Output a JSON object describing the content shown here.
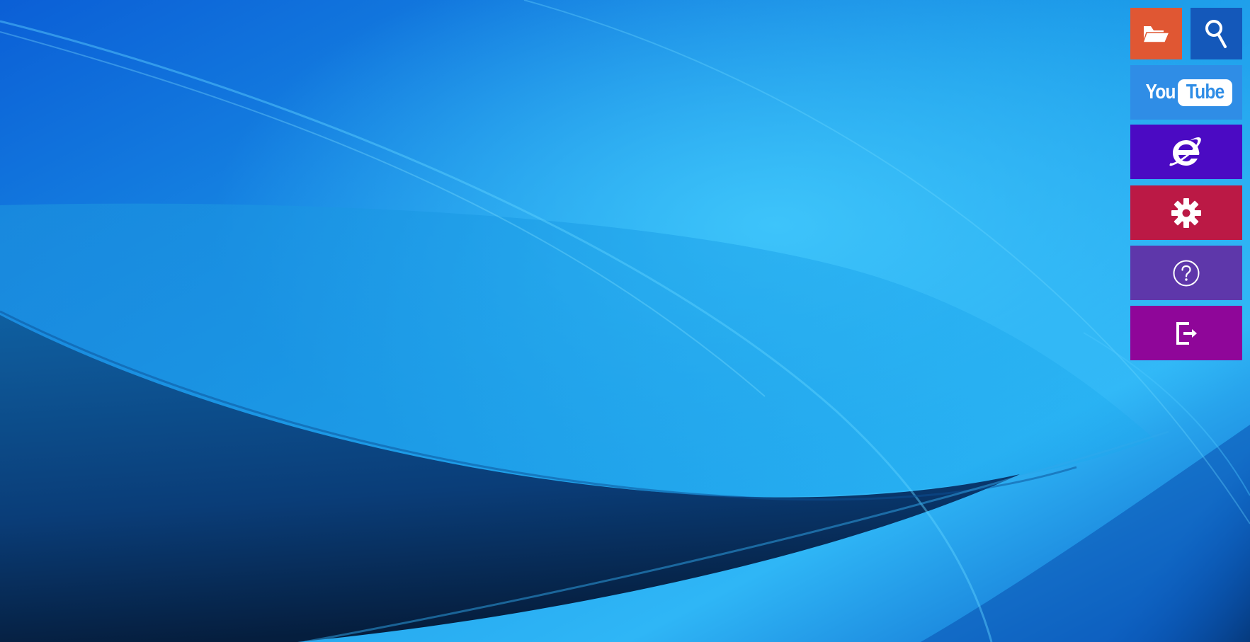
{
  "desktop": {
    "wallpaper": {
      "name": "blue-waves-wallpaper",
      "colors": [
        "#0a4fb8",
        "#1aa0ec",
        "#38c2fa",
        "#0b2a55"
      ]
    }
  },
  "tiles": [
    {
      "id": "file-explorer",
      "icon": "folder-open-icon",
      "color": "#e05733"
    },
    {
      "id": "search",
      "icon": "search-icon",
      "color": "#1458ba"
    },
    {
      "id": "youtube",
      "icon": "youtube-logo",
      "color": "#2f8de6",
      "logo_text": {
        "you": "You",
        "tube": "Tube"
      },
      "logo_text_color": "#2f8de6"
    },
    {
      "id": "internet-explorer",
      "icon": "internet-explorer-icon",
      "color": "#4b0ac3"
    },
    {
      "id": "settings",
      "icon": "gear-icon",
      "color": "#bb1945"
    },
    {
      "id": "help",
      "icon": "help-circle-icon",
      "color": "#5e37aa"
    },
    {
      "id": "sign-out",
      "icon": "exit-door-icon",
      "color": "#8f0699"
    }
  ]
}
